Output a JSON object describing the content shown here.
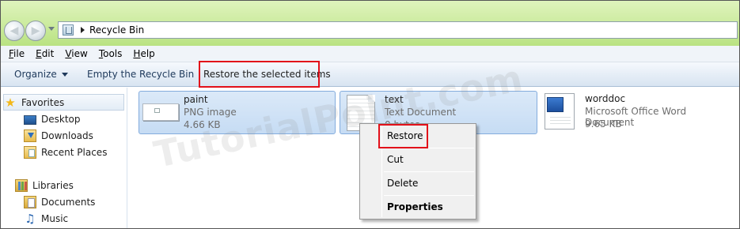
{
  "address": {
    "location": "Recycle Bin"
  },
  "menu": {
    "items": [
      "File",
      "Edit",
      "View",
      "Tools",
      "Help"
    ]
  },
  "commands": {
    "organize": "Organize",
    "empty": "Empty the Recycle Bin",
    "restore_selected": "Restore the selected items"
  },
  "nav": {
    "favorites": "Favorites",
    "desktop": "Desktop",
    "downloads": "Downloads",
    "recent": "Recent Places",
    "libraries": "Libraries",
    "documents": "Documents",
    "music": "Music"
  },
  "files": [
    {
      "name": "paint",
      "type": "PNG image",
      "size": "4.66 KB"
    },
    {
      "name": "text",
      "type": "Text Document",
      "size": "0 bytes"
    },
    {
      "name": "worddoc",
      "type": "Microsoft Office Word Document",
      "size": "9.65 KB"
    }
  ],
  "context_menu": {
    "restore": "Restore",
    "cut": "Cut",
    "delete": "Delete",
    "properties": "Properties"
  },
  "watermark": "TutorialPoint.com",
  "icons": [
    "back-arrow-icon",
    "forward-arrow-icon",
    "recycle-bin-icon",
    "star-icon",
    "desktop-icon",
    "downloads-folder-icon",
    "recent-places-icon",
    "libraries-icon",
    "documents-icon",
    "music-icon",
    "png-file-icon",
    "text-file-icon",
    "word-doc-icon"
  ],
  "colors": {
    "highlight_red": "#e2101a",
    "titlebar_green": "#c9ea9a",
    "selection_blue": "#c6dcf4"
  }
}
